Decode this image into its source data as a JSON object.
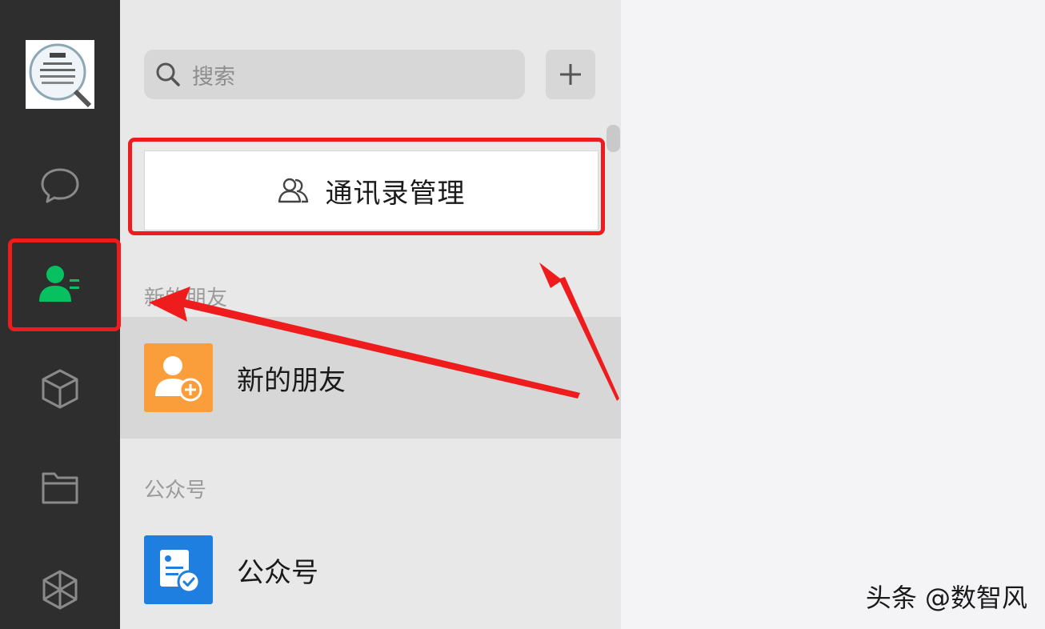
{
  "search": {
    "placeholder": "搜索"
  },
  "contacts_manager": {
    "label": "通讯录管理"
  },
  "sections": [
    {
      "header": "新的朋友",
      "item_label": "新的朋友"
    },
    {
      "header": "公众号",
      "item_label": "公众号"
    }
  ],
  "sidebar": {
    "items": [
      {
        "icon": "chat-bubble-icon"
      },
      {
        "icon": "contacts-icon",
        "active": true
      },
      {
        "icon": "cube-icon"
      },
      {
        "icon": "folder-icon"
      },
      {
        "icon": "moments-aperture-icon"
      }
    ]
  },
  "watermark": "头条 @数智风",
  "colors": {
    "sidebar_bg": "#2e2e2e",
    "active_green": "#07c160",
    "highlight_red": "#ee1c1c",
    "new_friend_orange": "#fa9d3b",
    "official_account_blue": "#1e7fe1"
  }
}
